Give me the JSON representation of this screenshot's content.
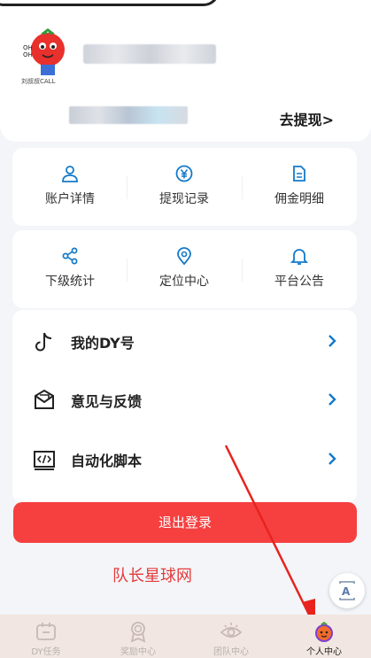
{
  "profile": {
    "avatar_caption": "刘叔叔CALL",
    "withdraw_link": "去提现>"
  },
  "grid1": [
    {
      "label": "账户详情",
      "icon": "user-icon"
    },
    {
      "label": "提现记录",
      "icon": "yen-circle-icon"
    },
    {
      "label": "佣金明细",
      "icon": "document-icon"
    }
  ],
  "grid2": [
    {
      "label": "下级统计",
      "icon": "share-icon"
    },
    {
      "label": "定位中心",
      "icon": "location-pin-icon"
    },
    {
      "label": "平台公告",
      "icon": "bell-icon"
    }
  ],
  "list": [
    {
      "label": "我的DY号",
      "icon": "tiktok-icon"
    },
    {
      "label": "意见与反馈",
      "icon": "envelope-icon"
    },
    {
      "label": "自动化脚本",
      "icon": "code-icon"
    }
  ],
  "logout_label": "退出登录",
  "watermark": "队长星球网",
  "tabs": [
    {
      "label": "DY任务",
      "icon": "task-box-icon"
    },
    {
      "label": "奖励中心",
      "icon": "award-icon"
    },
    {
      "label": "团队中心",
      "icon": "eye-icon"
    },
    {
      "label": "个人中心",
      "icon": "tomato-icon"
    }
  ],
  "colors": {
    "accent": "#1479c9",
    "logout": "#f64040",
    "tabbar": "#f1e6e1"
  }
}
